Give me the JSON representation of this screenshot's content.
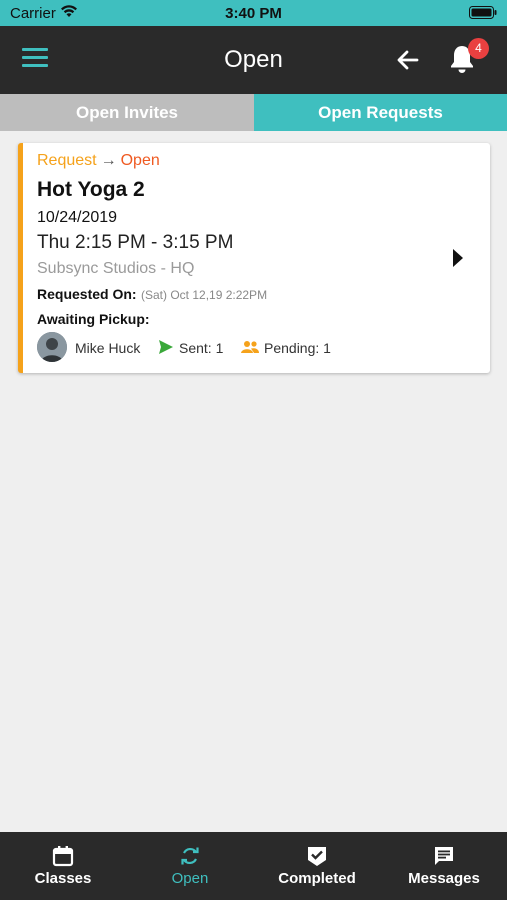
{
  "status_bar": {
    "carrier": "Carrier",
    "time": "3:40 PM"
  },
  "header": {
    "title": "Open",
    "notification_count": "4"
  },
  "tabs": [
    {
      "label": "Open Invites",
      "active": false
    },
    {
      "label": "Open Requests",
      "active": true
    }
  ],
  "card": {
    "status_from": "Request",
    "status_to": "Open",
    "class_name": "Hot Yoga 2",
    "date": "10/24/2019",
    "time_range": "Thu 2:15 PM - 3:15 PM",
    "location": "Subsync Studios - HQ",
    "requested_on_label": "Requested On:",
    "requested_on_value": "(Sat) Oct 12,19 2:22PM",
    "awaiting_label": "Awaiting Pickup:",
    "person_name": "Mike Huck",
    "sent": "Sent: 1",
    "pending": "Pending: 1"
  },
  "bottom_nav": [
    {
      "label": "Classes",
      "icon": "calendar-icon",
      "active": false
    },
    {
      "label": "Open",
      "icon": "refresh-icon",
      "active": true
    },
    {
      "label": "Completed",
      "icon": "check-badge-icon",
      "active": false
    },
    {
      "label": "Messages",
      "icon": "message-icon",
      "active": false
    }
  ],
  "colors": {
    "accent": "#3fbfbf",
    "header_bg": "#2a2a2a",
    "request_orange": "#f5a21b",
    "open_red_orange": "#ef5a22",
    "sent_green": "#3aa83a",
    "badge_red": "#e94040"
  }
}
